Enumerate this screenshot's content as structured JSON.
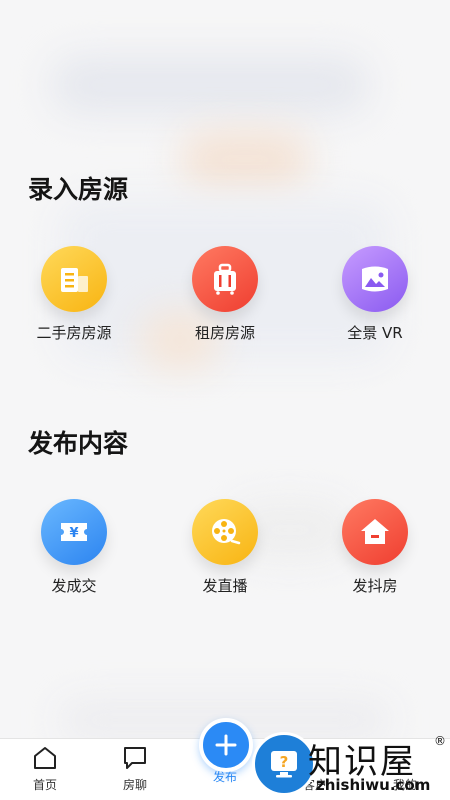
{
  "sections": {
    "entry": {
      "title": "录入房源",
      "items": [
        {
          "label": "二手房房源",
          "icon": "building-icon",
          "color": "#f8b412"
        },
        {
          "label": "租房房源",
          "icon": "luggage-icon",
          "color": "#ef3e30"
        },
        {
          "label": "全景 VR",
          "icon": "panorama-icon",
          "color": "#8a5af0"
        }
      ]
    },
    "publish": {
      "title": "发布内容",
      "items": [
        {
          "label": "发成交",
          "icon": "ticket-yen-icon",
          "color": "#2c84f0"
        },
        {
          "label": "发直播",
          "icon": "film-reel-icon",
          "color": "#f8b412"
        },
        {
          "label": "发抖房",
          "icon": "house-icon",
          "color": "#ef3e30"
        }
      ]
    }
  },
  "tabbar": {
    "home": "首页",
    "chat": "房聊",
    "publish": "发布",
    "customers": "客户",
    "mine": "我的",
    "active_color": "#2c8af4"
  },
  "watermark": {
    "title": "知识屋",
    "registered": "®",
    "url": "zhishiwu.com"
  }
}
